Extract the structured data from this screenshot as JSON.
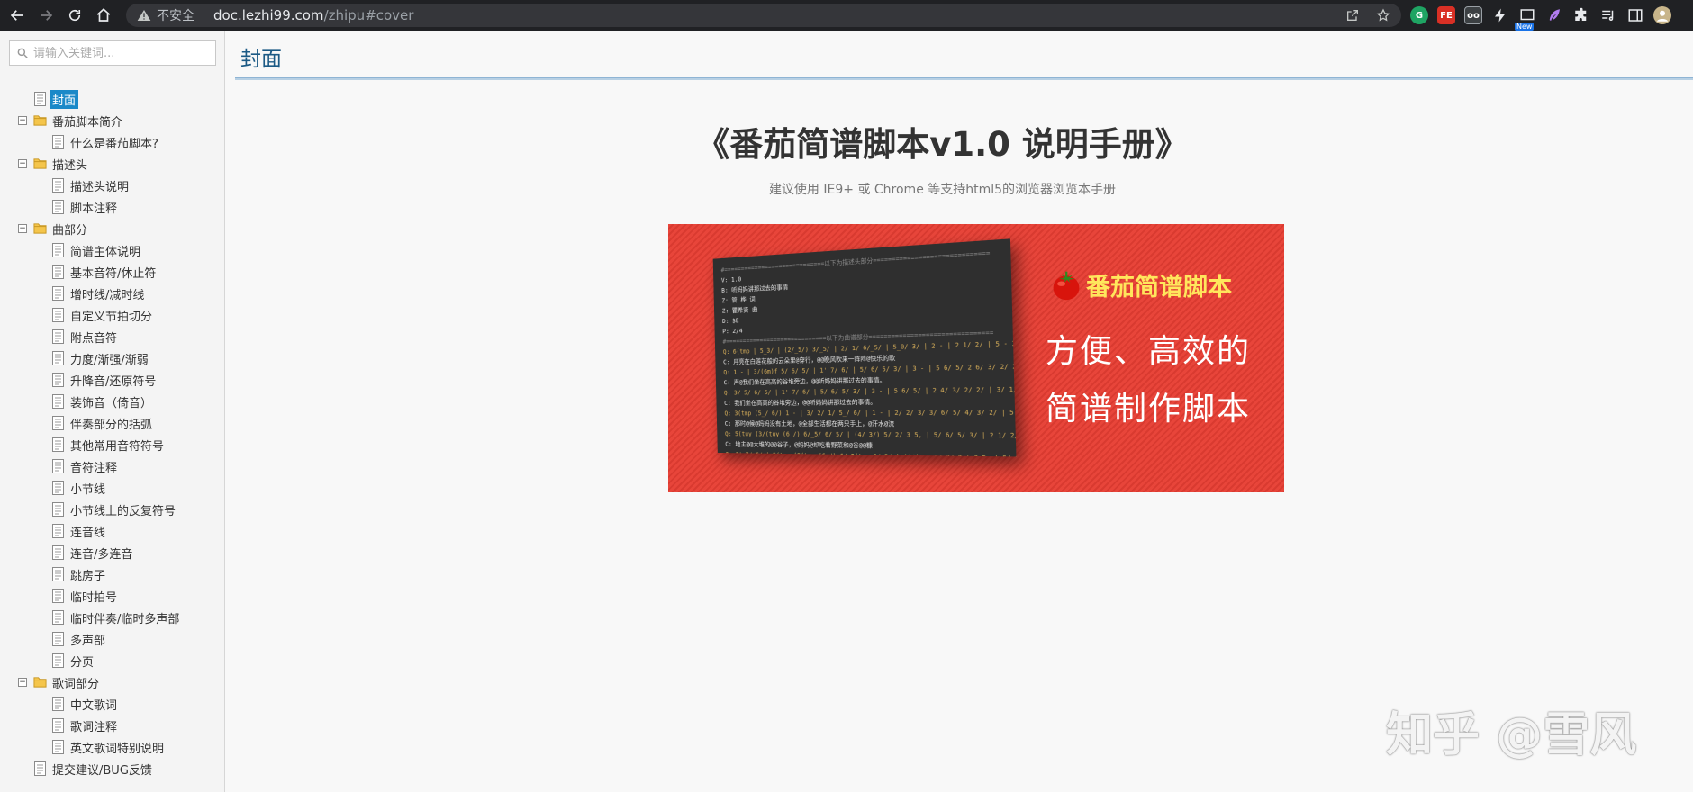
{
  "browser": {
    "insecure_label": "不安全",
    "url_host": "doc.lezhi99.com",
    "url_path": "/zhipu#cover",
    "ext_new_badge": "New",
    "ext_fe_label": "FE"
  },
  "sidebar": {
    "search_placeholder": "请输入关键词...",
    "tree": [
      {
        "label": "封面",
        "level": 0,
        "type": "doc",
        "active": true
      },
      {
        "label": "番茄脚本简介",
        "level": 0,
        "type": "folder"
      },
      {
        "label": "什么是番茄脚本?",
        "level": 1,
        "type": "doc"
      },
      {
        "label": "描述头",
        "level": 0,
        "type": "folder"
      },
      {
        "label": "描述头说明",
        "level": 1,
        "type": "doc"
      },
      {
        "label": "脚本注释",
        "level": 1,
        "type": "doc"
      },
      {
        "label": "曲部分",
        "level": 0,
        "type": "folder"
      },
      {
        "label": "简谱主体说明",
        "level": 1,
        "type": "doc"
      },
      {
        "label": "基本音符/休止符",
        "level": 1,
        "type": "doc"
      },
      {
        "label": "增时线/减时线",
        "level": 1,
        "type": "doc"
      },
      {
        "label": "自定义节拍切分",
        "level": 1,
        "type": "doc"
      },
      {
        "label": "附点音符",
        "level": 1,
        "type": "doc"
      },
      {
        "label": "力度/渐强/渐弱",
        "level": 1,
        "type": "doc"
      },
      {
        "label": "升降音/还原符号",
        "level": 1,
        "type": "doc"
      },
      {
        "label": "装饰音（倚音）",
        "level": 1,
        "type": "doc"
      },
      {
        "label": "伴奏部分的括弧",
        "level": 1,
        "type": "doc"
      },
      {
        "label": "其他常用音符符号",
        "level": 1,
        "type": "doc"
      },
      {
        "label": "音符注释",
        "level": 1,
        "type": "doc"
      },
      {
        "label": "小节线",
        "level": 1,
        "type": "doc"
      },
      {
        "label": "小节线上的反复符号",
        "level": 1,
        "type": "doc"
      },
      {
        "label": "连音线",
        "level": 1,
        "type": "doc"
      },
      {
        "label": "连音/多连音",
        "level": 1,
        "type": "doc"
      },
      {
        "label": "跳房子",
        "level": 1,
        "type": "doc"
      },
      {
        "label": "临时拍号",
        "level": 1,
        "type": "doc"
      },
      {
        "label": "临时伴奏/临时多声部",
        "level": 1,
        "type": "doc"
      },
      {
        "label": "多声部",
        "level": 1,
        "type": "doc"
      },
      {
        "label": "分页",
        "level": 1,
        "type": "doc"
      },
      {
        "label": "歌词部分",
        "level": 0,
        "type": "folder"
      },
      {
        "label": "中文歌词",
        "level": 1,
        "type": "doc"
      },
      {
        "label": "歌词注释",
        "level": 1,
        "type": "doc"
      },
      {
        "label": "英文歌词特别说明",
        "level": 1,
        "type": "doc"
      },
      {
        "label": "提交建议/BUG反馈",
        "level": 0,
        "type": "doc"
      }
    ]
  },
  "main": {
    "page_title": "封面",
    "doc_title": "《番茄简谱脚本v1.0 说明手册》",
    "doc_subtitle": "建议使用 IE9+ 或 Chrome 等支持html5的浏览器浏览本手册",
    "banner": {
      "brand": "番茄简谱脚本",
      "slogan_line1": "方便、高效的",
      "slogan_line2": "简谱制作脚本",
      "code_lines": [
        {
          "text": "#=============================以下为描述头部分==============================",
          "color": "#8a8a8a"
        },
        {
          "text": "V: 1.0",
          "color": "#e8e8e8"
        },
        {
          "text": "B: 听妈妈讲那过去的事情",
          "color": "#e8e8e8"
        },
        {
          "text": "Z: 管  桦 词",
          "color": "#e8e8e8"
        },
        {
          "text": "Z: 瞿希贤 曲",
          "color": "#e8e8e8"
        },
        {
          "text": "D: $E",
          "color": "#e8e8e8"
        },
        {
          "text": "P: 2/4",
          "color": "#e8e8e8"
        },
        {
          "text": "#=============================以下为曲谱部分================================",
          "color": "#8a8a8a"
        },
        {
          "text": "Q: 6(tmp | 5_3/ | (2/_5/) 3/_5/ | 2/ 1/ 6/_5/ | 5_0/ 3/ | 2 - | 2 1/ 2/ | 5 - 3/ |",
          "color": "#d9b05a"
        },
        {
          "text": "C: 月亮在白莲花般的云朵里@穿行，@@晚风吹来一阵阵@快乐的歌",
          "color": "#e8e8e8"
        },
        {
          "text": "Q: 1 - | 3/(6m)f 5/ 6/ 5/ | 1' 7/ 6/ | 5/ 6/ 5/ 3/ | 3 - | 5 6/ 5/ 2 6/ 3/ 2/ 2/ 6/ 5/",
          "color": "#d9b05a"
        },
        {
          "text": "C: 声@我们坐在高高的谷堆旁边，@@听妈妈讲那过去的事情。",
          "color": "#e8e8e8"
        },
        {
          "text": "Q: 3/ 5/ 6/ 5/ | 1' 7/ 6/ | 5/ 6/ 5/ 3/ | 3 - | 5 6/ 5/ | 2 4/ 3/ 2/ 2/ | 3/ 1/ | 3(hp - 3)(hiv",
          "color": "#d9b05a"
        },
        {
          "text": "C: 我们坐在高高的谷堆旁边，@@听妈妈讲那过去的事情。",
          "color": "#e8e8e8"
        },
        {
          "text": "Q: 3(tmp (5_/ 6/) 1 - | 3/ 2/ 1/ 5_/ 6/ | 1 - | 2/ 2/ 3/ 3/ 6/ 5/ 4/ 3/ 2/ | 5 - | 6(tmp |",
          "color": "#d9b05a"
        },
        {
          "text": "C: 那时@候@妈妈没有土地，@全部生活都在两只手上，@汗水@流",
          "color": "#e8e8e8"
        },
        {
          "text": "Q: 5(tuy (3/(tuy (6 /) 6/_5/ 6/ 5/ | (4/ 3/) 5/ 2/ 3 5, | 5/ 6/ 5/ 3/ | 2 1/ 2/ 3/ 6/ | 1 - |",
          "color": "#d9b05a"
        },
        {
          "text": "C: 地主@@大堆的@@谷子，@妈妈@却吃着野菜和@谷@@糠",
          "color": "#e8e8e8"
        },
        {
          "text": "Q: 1' 7/ 6/ | 5(tuy (3(tuy (6 /) 6/ 5(tuy 6/ 5/ | (4/(tuy 3/ 3/ 2 | 3 5, | 5/ 6/ 5/ 3/ | 2 1/ 2/ |",
          "color": "#d9b05a"
        }
      ]
    },
    "watermark": "知乎 @雪风"
  },
  "colors": {
    "accent": "#1a89c8",
    "title_blue": "#1c5a85",
    "banner_red": "#e8453a",
    "brand_yellow": "#ffe65c"
  }
}
